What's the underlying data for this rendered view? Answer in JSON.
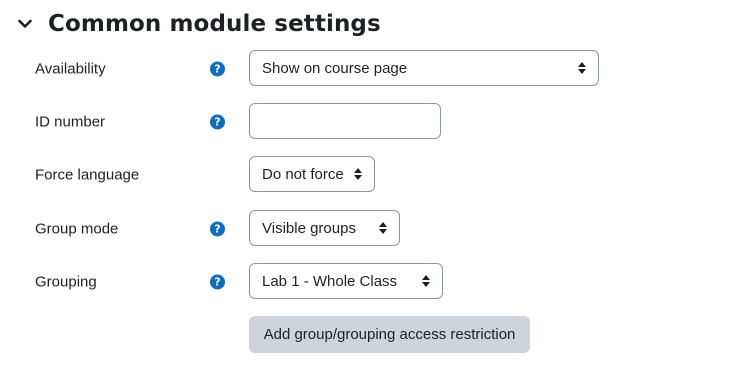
{
  "section": {
    "title": "Common module settings",
    "expanded": true
  },
  "fields": {
    "availability": {
      "label": "Availability",
      "value": "Show on course page",
      "has_help": true
    },
    "id_number": {
      "label": "ID number",
      "value": "",
      "has_help": true
    },
    "force_language": {
      "label": "Force language",
      "value": "Do not force",
      "has_help": false
    },
    "group_mode": {
      "label": "Group mode",
      "value": "Visible groups",
      "has_help": true
    },
    "grouping": {
      "label": "Grouping",
      "value": "Lab 1 - Whole Class",
      "has_help": true
    }
  },
  "help_glyph": "?",
  "buttons": {
    "add_restriction": "Add group/grouping access restriction"
  },
  "colors": {
    "help_icon": "#0f6cbf",
    "button_bg": "#ced4da",
    "border": "#8f959e"
  }
}
